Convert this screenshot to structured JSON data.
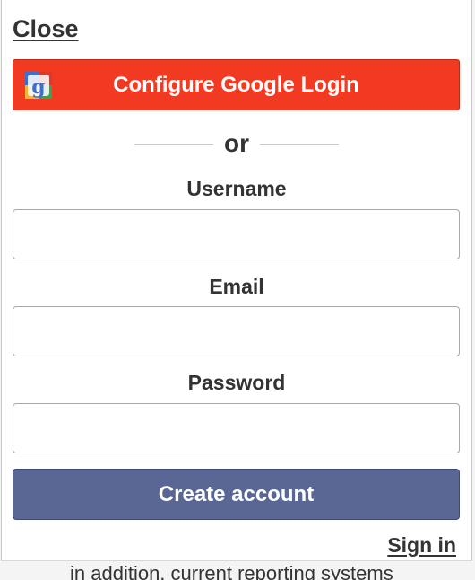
{
  "modal": {
    "close_label": "Close",
    "google_button_label": "Configure Google Login",
    "divider_text": "or",
    "fields": {
      "username": {
        "label": "Username",
        "value": "",
        "placeholder": ""
      },
      "email": {
        "label": "Email",
        "value": "",
        "placeholder": ""
      },
      "password": {
        "label": "Password",
        "value": "",
        "placeholder": ""
      }
    },
    "create_button_label": "Create account",
    "signin_label": "Sign in"
  },
  "background": {
    "partial_text": "in addition, current reporting systems"
  },
  "icons": {
    "google": "google-g-icon"
  },
  "colors": {
    "google_button": "#f23a22",
    "create_button": "#5a6694",
    "text": "#333333"
  }
}
